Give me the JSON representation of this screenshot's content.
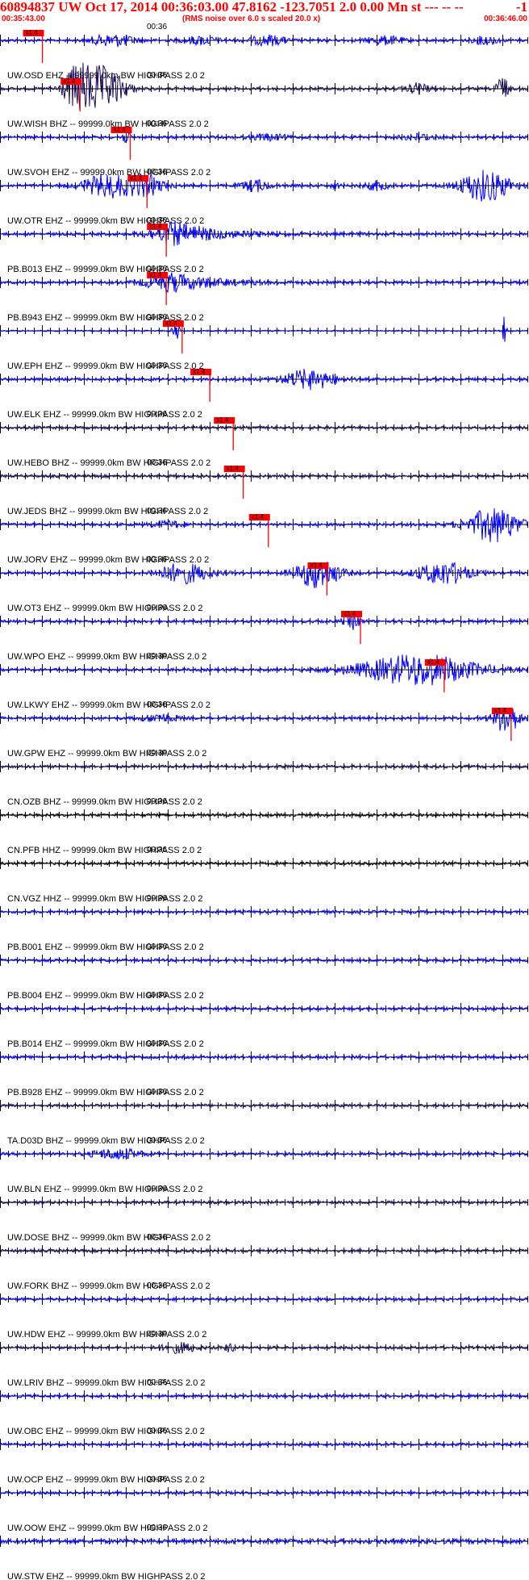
{
  "header": {
    "title": "60894837 UW Oct 17, 2014 00:36:03.00   47.8162 -123.7051  2.0 0.00 Mn st --- -- --",
    "title_right": "-1",
    "start_time": "00:35:43.00",
    "note": "(RMS noise over 6.0 s scaled 20.0 x)",
    "end_time": "00:36:46.00"
  },
  "colors": {
    "header": "#ff0000",
    "trace_blue": "#0000ff",
    "trace_dark": "#1a0a5a",
    "trace_black": "#000000",
    "pick": "#ff0000"
  },
  "chart_data": {
    "type": "line",
    "title": "60894837 UW Oct 17, 2014 00:36:03.00   47.8162 -123.7051  2.0 0.00 Mn st --- -- --",
    "x_range": [
      "00:35:43.00",
      "00:36:46.00"
    ],
    "x_range_s": [
      0,
      63
    ],
    "tick_label": "00:36",
    "pick_label": "x1.4",
    "traces": [
      {
        "label": "UW.OSD EHZ -- 99999.0km BW  HIGHPASS  2.0  2",
        "color": "blue",
        "pick_s": 4.0,
        "bursts": [
          [
            13.5,
            2.5,
            3
          ],
          [
            24,
            2,
            2
          ],
          [
            32,
            2,
            2.5
          ],
          [
            46,
            2,
            2
          ],
          [
            58,
            1.5,
            2
          ]
        ]
      },
      {
        "label": "UW.WISH BHZ -- 99999.0km BW  HIGHPASS  2.0  2",
        "color": "dark",
        "pick_s": 8.5,
        "bursts": [
          [
            9,
            1.5,
            7
          ],
          [
            11,
            2.5,
            10
          ],
          [
            13.5,
            2,
            5
          ],
          [
            50,
            1.2,
            3
          ],
          [
            60,
            0.6,
            8
          ]
        ]
      },
      {
        "label": "UW.SVOH EHZ -- 99999.0km BW  HIGHPASS  2.0  2",
        "color": "blue",
        "pick_s": 14.5,
        "bursts": [
          [
            15,
            0.6,
            2.5
          ],
          [
            32,
            2,
            1.5
          ],
          [
            50,
            2,
            1.5
          ]
        ]
      },
      {
        "label": "UW.OTR EHZ -- 99999.0km BW  HIGHPASS  2.0  2",
        "color": "blue",
        "pick_s": 16.5,
        "bursts": [
          [
            13,
            3,
            6
          ],
          [
            17.5,
            2,
            5
          ],
          [
            30.5,
            1.5,
            3
          ],
          [
            40,
            0.6,
            1.5
          ],
          [
            45,
            1.5,
            2
          ],
          [
            58,
            3,
            8
          ]
        ]
      },
      {
        "label": "PB.B013 EHZ -- 99999.0km BW  HIGHPASS  2.0  2",
        "color": "blue",
        "pick_s": 18.8,
        "bursts": [
          [
            21,
            3,
            6
          ]
        ],
        "decay": true
      },
      {
        "label": "PB.B943 EHZ -- 99999.0km BW  HIGHPASS  2.0  2",
        "color": "blue",
        "pick_s": 18.8,
        "bursts": [
          [
            20.5,
            3,
            5
          ]
        ],
        "decay": true
      },
      {
        "label": "UW.EPH EHZ -- 99999.0km BW  HIGHPASS  2.0  2",
        "color": "blue",
        "pick_s": 20.7,
        "bursts": [
          [
            21,
            0.4,
            6
          ],
          [
            60.3,
            0.25,
            8
          ]
        ],
        "quiet": true
      },
      {
        "label": "UW.ELK EHZ -- 99999.0km BW  HIGHPASS  2.0  2",
        "color": "blue",
        "pick_s": 24.0,
        "bursts": [
          [
            37,
            3,
            5
          ]
        ]
      },
      {
        "label": "UW.HEBO BHZ -- 99999.0km BW  HIGHPASS  2.0  2",
        "color": "dark",
        "pick_s": 26.8,
        "bursts": []
      },
      {
        "label": "UW.JEDS BHZ -- 99999.0km BW  HIGHPASS  2.0  2",
        "color": "dark",
        "pick_s": 28.0,
        "bursts": []
      },
      {
        "label": "UW.JORV EHZ -- 99999.0km BW  HIGHPASS  2.0  2",
        "color": "blue",
        "pick_s": 31.0,
        "bursts": [
          [
            59,
            3,
            9
          ],
          [
            20,
            2,
            1.5
          ]
        ]
      },
      {
        "label": "UW.OT3 EHZ -- 99999.0km BW  HIGHPASS  2.0  2",
        "color": "blue",
        "pick_s": 38.0,
        "bursts": [
          [
            22,
            3,
            5
          ],
          [
            38,
            2.5,
            8
          ],
          [
            53,
            3,
            6
          ]
        ]
      },
      {
        "label": "UW.WPO EHZ -- 99999.0km BW  HIGHPASS  2.0  2",
        "color": "blue",
        "pick_s": 42.0,
        "bursts": [
          [
            42,
            1,
            4
          ]
        ]
      },
      {
        "label": "UW.LKWY EHZ -- 99999.0km BW  HIGHPASS  2.0  2",
        "color": "blue",
        "pick_s": 52.0,
        "bursts": [
          [
            50,
            7,
            8
          ]
        ]
      },
      {
        "label": "UW.GPW EHZ -- 99999.0km BW  HIGHPASS  2.0  2",
        "color": "blue",
        "pick_s": 60.0,
        "bursts": [
          [
            60.5,
            1.5,
            8
          ],
          [
            19,
            2,
            2
          ]
        ]
      },
      {
        "label": "CN.OZB BHZ -- 99999.0km BW  HIGHPASS  2.0  2",
        "color": "dark",
        "bursts": []
      },
      {
        "label": "CN.PFB HHZ -- 99999.0km BW  HIGHPASS  2.0  2",
        "color": "black",
        "bursts": []
      },
      {
        "label": "CN.VGZ HHZ -- 99999.0km BW  HIGHPASS  2.0  2",
        "color": "black",
        "bursts": []
      },
      {
        "label": "PB.B001 EHZ -- 99999.0km BW  HIGHPASS  2.0  2",
        "color": "blue",
        "bursts": []
      },
      {
        "label": "PB.B004 EHZ -- 99999.0km BW  HIGHPASS  2.0  2",
        "color": "blue",
        "bursts": []
      },
      {
        "label": "PB.B014 EHZ -- 99999.0km BW  HIGHPASS  2.0  2",
        "color": "blue",
        "bursts": []
      },
      {
        "label": "PB.B928 EHZ -- 99999.0km BW  HIGHPASS  2.0  2",
        "color": "blue",
        "bursts": []
      },
      {
        "label": "TA.D03D BHZ -- 99999.0km BW  HIGHPASS  2.0  2",
        "color": "dark",
        "bursts": []
      },
      {
        "label": "UW.BLN EHZ -- 99999.0km BW  HIGHPASS  2.0  2",
        "color": "blue",
        "bursts": [
          [
            14,
            3,
            2.5
          ]
        ]
      },
      {
        "label": "UW.DOSE BHZ -- 99999.0km BW  HIGHPASS  2.0  2",
        "color": "dark",
        "bursts": []
      },
      {
        "label": "UW.FORK BHZ -- 99999.0km BW  HIGHPASS  2.0  2",
        "color": "dark",
        "bursts": []
      },
      {
        "label": "UW.HDW EHZ -- 99999.0km BW  HIGHPASS  2.0  2",
        "color": "blue",
        "bursts": []
      },
      {
        "label": "UW.LRIV BHZ -- 99999.0km BW  HIGHPASS  2.0  2",
        "color": "dark",
        "bursts": [
          [
            21.5,
            2,
            2.5
          ],
          [
            27.5,
            0.6,
            2
          ]
        ]
      },
      {
        "label": "UW.OBC EHZ -- 99999.0km BW  HIGHPASS  2.0  2",
        "color": "blue",
        "bursts": []
      },
      {
        "label": "UW.OCP EHZ -- 99999.0km BW  HIGHPASS  2.0  2",
        "color": "blue",
        "bursts": []
      },
      {
        "label": "UW.OOW EHZ -- 99999.0km BW  HIGHPASS  2.0  2",
        "color": "blue",
        "bursts": []
      },
      {
        "label": "UW.STW EHZ -- 99999.0km BW  HIGHPASS  2.0  2",
        "color": "blue",
        "bursts": [],
        "dense": true
      }
    ]
  }
}
